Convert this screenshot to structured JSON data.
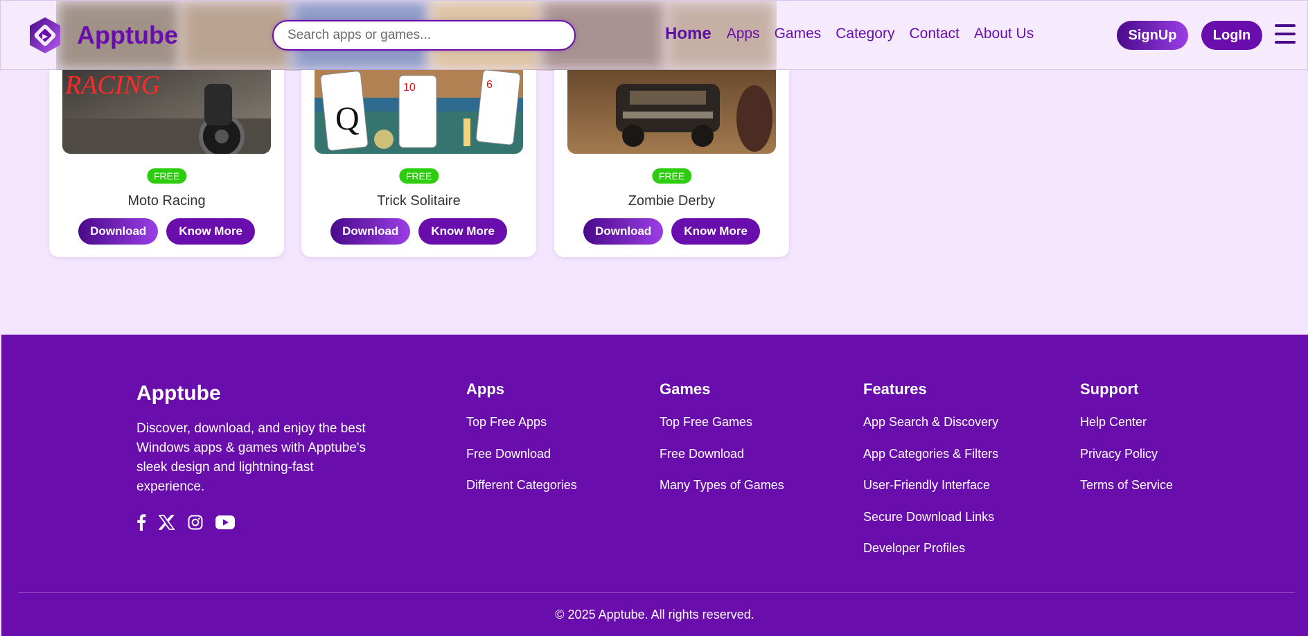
{
  "header": {
    "brand": "Apptube",
    "search_placeholder": "Search apps or games...",
    "nav": [
      "Home",
      "Apps",
      "Games",
      "Category",
      "Contact",
      "About Us"
    ],
    "signup_label": "SignUp",
    "login_label": "LogIn"
  },
  "cards": [
    {
      "badge": "FREE",
      "title": "Moto Racing",
      "image_text": "RACING",
      "download_label": "Download",
      "more_label": "Know More"
    },
    {
      "badge": "FREE",
      "title": "Trick Solitaire",
      "download_label": "Download",
      "more_label": "Know More"
    },
    {
      "badge": "FREE",
      "title": "Zombie Derby",
      "download_label": "Download",
      "more_label": "Know More"
    }
  ],
  "footer": {
    "brand": "Apptube",
    "description": "Discover, download, and enjoy the best Windows apps & games with Apptube's sleek design and lightning-fast experience.",
    "socials": [
      "facebook-icon",
      "x-icon",
      "instagram-icon",
      "youtube-icon"
    ],
    "columns": [
      {
        "title": "Apps",
        "links": [
          "Top Free Apps",
          "Free Download",
          "Different Categories"
        ]
      },
      {
        "title": "Games",
        "links": [
          "Top Free Games",
          "Free Download",
          "Many Types of Games"
        ]
      },
      {
        "title": "Features",
        "links": [
          "App Search & Discovery",
          "App Categories & Filters",
          "User-Friendly Interface",
          "Secure Download Links",
          "Developer Profiles"
        ]
      },
      {
        "title": "Support",
        "links": [
          "Help Center",
          "Privacy Policy",
          "Terms of Service"
        ]
      }
    ],
    "copyright": "© 2025 Apptube. All rights reserved."
  },
  "colors": {
    "brand": "#6a0dad",
    "accent": "#9b3ee6",
    "free_badge": "#2dcc0e",
    "page_bg": "#f3e5fd"
  }
}
